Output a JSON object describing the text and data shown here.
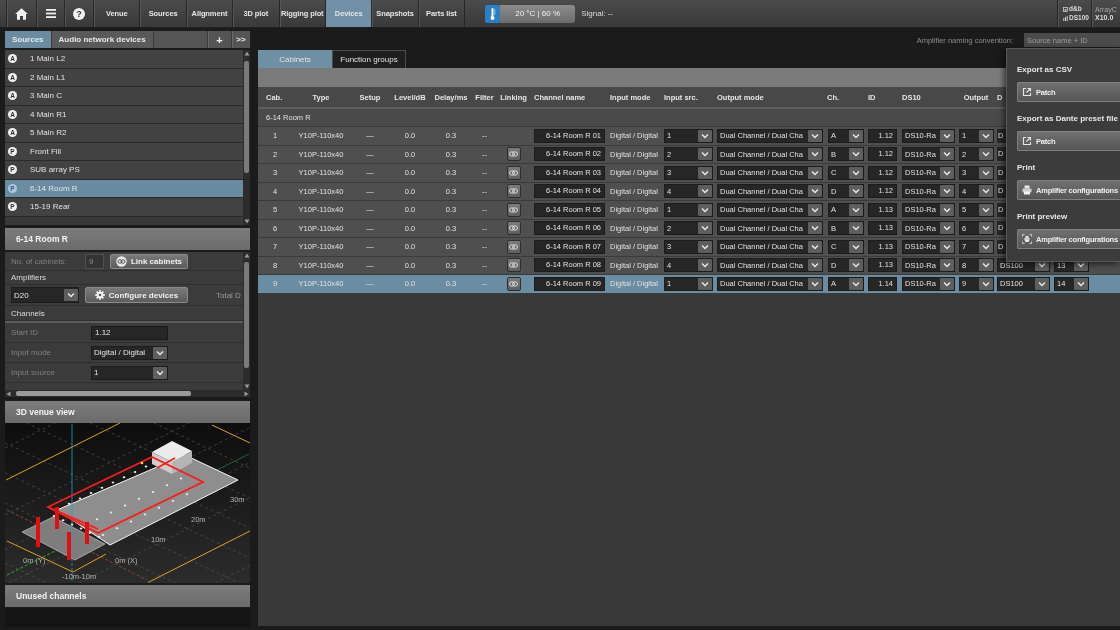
{
  "toolbar": {
    "help_button": "?",
    "tabs": [
      {
        "label": "Venue",
        "selected": false
      },
      {
        "label": "Sources",
        "selected": false
      },
      {
        "label": "Alignment",
        "selected": false
      },
      {
        "label": "3D plot",
        "selected": false
      },
      {
        "label": "Rigging plot",
        "selected": false
      },
      {
        "label": "Devices",
        "selected": true
      },
      {
        "label": "Snapshots",
        "selected": false
      },
      {
        "label": "Parts list",
        "selected": false
      }
    ],
    "climate": "20 °C | 60 %",
    "signal": "Signal: --",
    "device": {
      "maker": "d&b",
      "model": "DS100"
    },
    "app_version": {
      "name": "ArrayC",
      "number": "X10.0"
    }
  },
  "sidebar": {
    "tabs": [
      {
        "label": "Sources",
        "selected": true
      },
      {
        "label": "Audio network devices",
        "selected": false
      }
    ],
    "add_button": "+",
    "expand_button": ">>",
    "sources": [
      {
        "badge": "A",
        "name": "1 Main L2",
        "selected": false
      },
      {
        "badge": "A",
        "name": "2 Main L1",
        "selected": false
      },
      {
        "badge": "A",
        "name": "3 Main C",
        "selected": false
      },
      {
        "badge": "A",
        "name": "4 Main R1",
        "selected": false
      },
      {
        "badge": "A",
        "name": "5 Main R2",
        "selected": false
      },
      {
        "badge": "P",
        "name": "Front Fill",
        "selected": false
      },
      {
        "badge": "P",
        "name": "SUB array PS",
        "selected": false
      },
      {
        "badge": "P",
        "name": "6-14 Room R",
        "selected": true
      },
      {
        "badge": "P",
        "name": "15-19 Rear",
        "selected": false
      }
    ]
  },
  "source_panel": {
    "title": "6-14 Room R",
    "cabinets": {
      "label": "No. of cabinets:",
      "value": "9",
      "disabled": true
    },
    "link_button": "Link cabinets",
    "amplifiers_label": "Amplifiers",
    "amplifier": "D20",
    "configure_button": "Configure devices",
    "total_label": "Total D",
    "channels_label": "Channels",
    "fields": [
      {
        "kind": "text",
        "label": "Start ID",
        "value": "1.12"
      },
      {
        "kind": "dropdown",
        "label": "Input mode",
        "value": "Digital / Digital"
      },
      {
        "kind": "dropdown",
        "label": "Input source",
        "value": "1"
      }
    ]
  },
  "venue_view": {
    "title": "3D venue view",
    "axis_labels": [
      "30m",
      "20m",
      "10m",
      "0m (Y)",
      "0m (X)",
      "-10m-10m"
    ]
  },
  "unused_channels": {
    "title": "Unused channels"
  },
  "naming_convention": {
    "label": "Amplifier naming convention:",
    "placeholder": "Source name + ID"
  },
  "device_tabs": [
    {
      "label": "Cabinets",
      "selected": true
    },
    {
      "label": "Function groups",
      "selected": false
    }
  ],
  "table": {
    "columns": [
      "Cab.",
      "Type",
      "Setup",
      "Level/dB",
      "Delay/ms",
      "Filter",
      "Linking",
      "Channel name",
      "Input mode",
      "Input src.",
      "Output mode",
      "Ch.",
      "ID",
      "DS10",
      "Output",
      "D"
    ],
    "group": "6-14 Room R",
    "rows": [
      {
        "cab": "1",
        "type": "Y10P-110x40",
        "setup": "—",
        "level": "0.0",
        "delay": "0.3",
        "filter": "--",
        "linked": false,
        "channel_name": "6-14 Room R 01",
        "input_mode": "Digital / Digital",
        "input_src": "1",
        "output_mode": "Dual Channel / Dual Cha",
        "ch": "A",
        "id": "1.12",
        "ds10": "DS10-Ra",
        "output": "1",
        "column_16": "D",
        "selected": false
      },
      {
        "cab": "2",
        "type": "Y10P-110x40",
        "setup": "—",
        "level": "0.0",
        "delay": "0.3",
        "filter": "--",
        "linked": true,
        "channel_name": "6-14 Room R 02",
        "input_mode": "Digital / Digital",
        "input_src": "2",
        "output_mode": "Dual Channel / Dual Cha",
        "ch": "B",
        "id": "1.12",
        "ds10": "DS10-Ra",
        "output": "2",
        "column_16": "D",
        "selected": false
      },
      {
        "cab": "3",
        "type": "Y10P-110x40",
        "setup": "—",
        "level": "0.0",
        "delay": "0.3",
        "filter": "--",
        "linked": true,
        "channel_name": "6-14 Room R 03",
        "input_mode": "Digital / Digital",
        "input_src": "3",
        "output_mode": "Dual Channel / Dual Cha",
        "ch": "C",
        "id": "1.12",
        "ds10": "DS10-Ra",
        "output": "3",
        "column_16": "D",
        "selected": false
      },
      {
        "cab": "4",
        "type": "Y10P-110x40",
        "setup": "—",
        "level": "0.0",
        "delay": "0.3",
        "filter": "--",
        "linked": true,
        "channel_name": "6-14 Room R 04",
        "input_mode": "Digital / Digital",
        "input_src": "4",
        "output_mode": "Dual Channel / Dual Cha",
        "ch": "D",
        "id": "1.12",
        "ds10": "DS10-Ra",
        "output": "4",
        "column_16": "D",
        "selected": false
      },
      {
        "cab": "5",
        "type": "Y10P-110x40",
        "setup": "—",
        "level": "0.0",
        "delay": "0.3",
        "filter": "--",
        "linked": true,
        "channel_name": "6-14 Room R 05",
        "input_mode": "Digital / Digital",
        "input_src": "1",
        "output_mode": "Dual Channel / Dual Cha",
        "ch": "A",
        "id": "1.13",
        "ds10": "DS10-Ra",
        "output": "5",
        "column_16": "D",
        "selected": false
      },
      {
        "cab": "6",
        "type": "Y10P-110x40",
        "setup": "—",
        "level": "0.0",
        "delay": "0.3",
        "filter": "--",
        "linked": true,
        "channel_name": "6-14 Room R 06",
        "input_mode": "Digital / Digital",
        "input_src": "2",
        "output_mode": "Dual Channel / Dual Cha",
        "ch": "B",
        "id": "1.13",
        "ds10": "DS10-Ra",
        "output": "6",
        "column_16": "D",
        "selected": false
      },
      {
        "cab": "7",
        "type": "Y10P-110x40",
        "setup": "—",
        "level": "0.0",
        "delay": "0.3",
        "filter": "--",
        "linked": true,
        "channel_name": "6-14 Room R 07",
        "input_mode": "Digital / Digital",
        "input_src": "3",
        "output_mode": "Dual Channel / Dual Cha",
        "ch": "C",
        "id": "1.13",
        "ds10": "DS10-Ra",
        "output": "7",
        "column_16": "D",
        "selected": false
      },
      {
        "cab": "8",
        "type": "Y10P-110x40",
        "setup": "—",
        "level": "0.0",
        "delay": "0.3",
        "filter": "--",
        "linked": true,
        "channel_name": "6-14 Room R 08",
        "input_mode": "Digital / Digital",
        "input_src": "4",
        "output_mode": "Dual Channel / Dual Cha",
        "ch": "D",
        "id": "1.13",
        "ds10": "DS10-Ra",
        "output": "8",
        "column_16": "DS100",
        "column_17": "13",
        "selected": false
      },
      {
        "cab": "9",
        "type": "Y10P-110x40",
        "setup": "—",
        "level": "0.0",
        "delay": "0.3",
        "filter": "--",
        "linked": true,
        "channel_name": "6-14 Room R 09",
        "input_mode": "Digital / Digital",
        "input_src": "1",
        "output_mode": "Dual Channel / Dual Cha",
        "ch": "A",
        "id": "1.14",
        "ds10": "DS10-Ra",
        "output": "9",
        "column_16": "DS100",
        "column_17": "14",
        "selected": true
      }
    ]
  },
  "export_menu": {
    "sections": [
      {
        "title": "Export as CSV",
        "button": "Patch",
        "kind": "export"
      },
      {
        "title": "Export as Dante preset file",
        "button": "Patch",
        "kind": "export"
      },
      {
        "title": "Print",
        "button": "Amplifier configurations",
        "kind": "print"
      },
      {
        "title": "Print preview",
        "button": "Amplifier configurations",
        "kind": "preview"
      }
    ]
  }
}
